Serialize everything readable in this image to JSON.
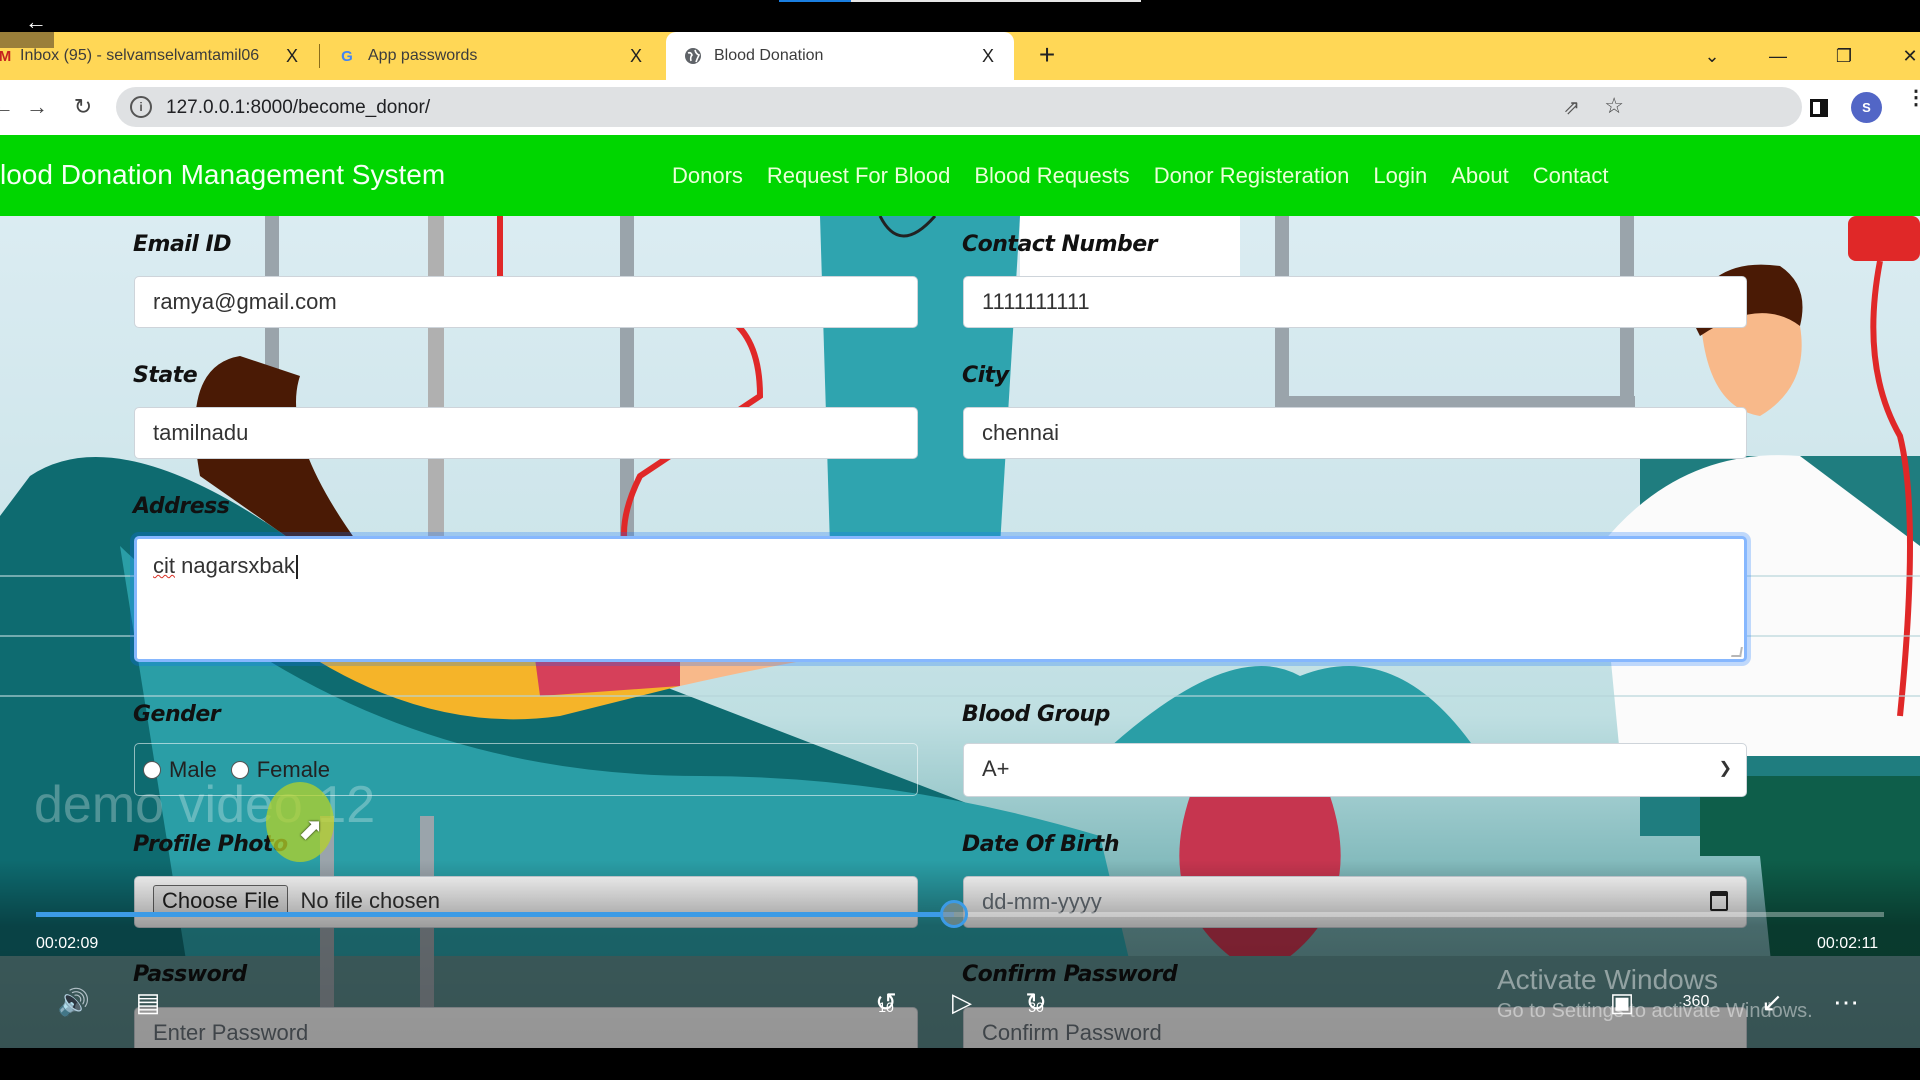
{
  "video_player": {
    "back_icon": "arrow-left-icon",
    "current_time": "00:02:09",
    "total_time": "00:02:11",
    "progress_fraction": 0.497,
    "watermark": "demo video 12",
    "controls": {
      "volume_icon": "volume-icon",
      "captions_icon": "captions-icon",
      "rewind_label": "10",
      "play_icon": "play-icon",
      "forward_label": "30",
      "miniplayer_icon": "miniplayer-icon",
      "view360_label": "360",
      "exit_fullscreen_icon": "exit-fullscreen-icon",
      "more_icon": "more-icon"
    }
  },
  "browser": {
    "tabs": [
      {
        "title": "Inbox (95) - selvamselvamtamil06",
        "icon": "gmail-icon",
        "active": false
      },
      {
        "title": "App passwords",
        "icon": "google-icon",
        "active": false
      },
      {
        "title": "Blood Donation",
        "icon": "globe-icon",
        "active": true
      }
    ],
    "close_glyph": "X",
    "new_tab_glyph": "+",
    "url": "127.0.0.1:8000/become_donor/",
    "profile_initial": "S",
    "colors": {
      "tabstrip": "#ffd756",
      "omnibox": "#dfe1e3",
      "avatar": "#5266c6"
    }
  },
  "site": {
    "brand": "lood Donation Management System",
    "nav": [
      "Donors",
      "Request For Blood",
      "Blood Requests",
      "Donor Registeration",
      "Login",
      "About",
      "Contact"
    ],
    "colors": {
      "navbar": "#00d600",
      "nav_text": "#eaffd8"
    }
  },
  "form": {
    "email": {
      "label": "Email ID",
      "value": "ramya@gmail.com"
    },
    "contact": {
      "label": "Contact Number",
      "value": "1111111111"
    },
    "state": {
      "label": "State",
      "value": "tamilnadu"
    },
    "city": {
      "label": "City",
      "value": "chennai"
    },
    "address": {
      "label": "Address",
      "value_misspelled": "cit",
      "value_rest": " nagarsxbak"
    },
    "gender": {
      "label": "Gender",
      "options": [
        "Male",
        "Female"
      ],
      "selected": null
    },
    "blood_group": {
      "label": "Blood Group",
      "selected": "A+"
    },
    "profile_photo": {
      "label": "Profile Photo",
      "button": "Choose File",
      "status": "No file chosen"
    },
    "dob": {
      "label": "Date Of Birth",
      "placeholder": "dd-mm-yyyy"
    },
    "password": {
      "label": "Password",
      "placeholder": "Enter Password"
    },
    "confirm_password": {
      "label": "Confirm Password",
      "placeholder": "Confirm Password"
    }
  },
  "system": {
    "activate_title": "Activate Windows",
    "activate_sub": "Go to Settings to activate Windows."
  }
}
